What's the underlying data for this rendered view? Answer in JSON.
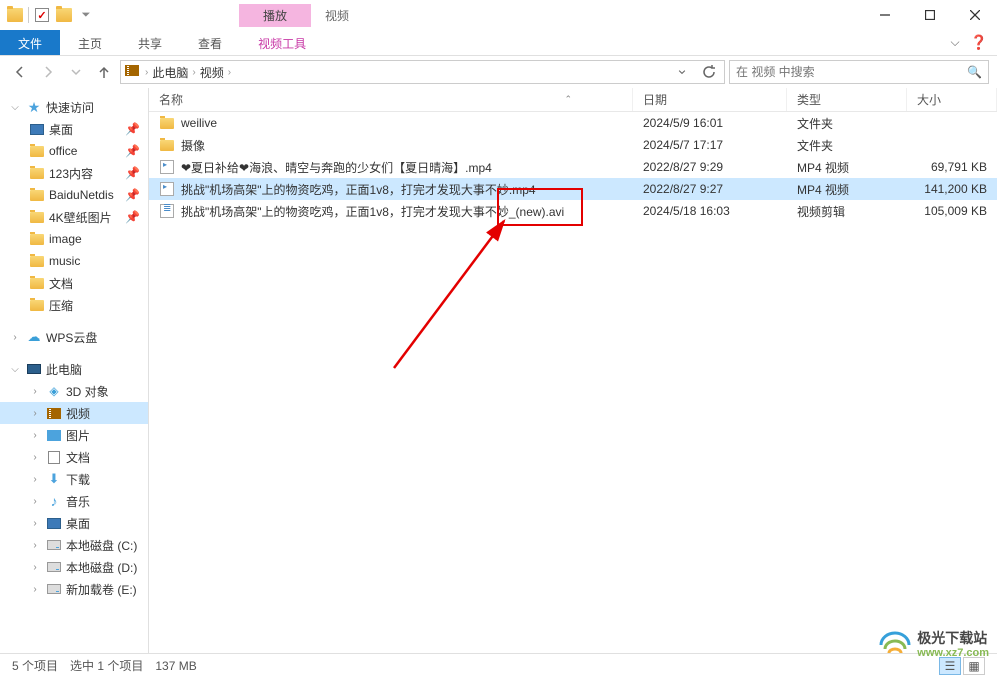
{
  "titlebar": {
    "play_label": "播放",
    "video_label": "视频"
  },
  "ribbon": {
    "tabs": [
      "文件",
      "主页",
      "共享",
      "查看",
      "视频工具"
    ]
  },
  "address": {
    "crumbs": [
      "此电脑",
      "视频"
    ],
    "search_placeholder": "在 视频 中搜索"
  },
  "columns": {
    "name": "名称",
    "date": "日期",
    "type": "类型",
    "size": "大小"
  },
  "files": [
    {
      "icon": "folder",
      "name": "weilive",
      "date": "2024/5/9 16:01",
      "type": "文件夹",
      "size": ""
    },
    {
      "icon": "folder",
      "name": "摄像",
      "date": "2024/5/7 17:17",
      "type": "文件夹",
      "size": ""
    },
    {
      "icon": "mp4",
      "name": "❤夏日补给❤海浪、晴空与奔跑的少女们【夏日晴海】.mp4",
      "date": "2022/8/27 9:29",
      "type": "MP4 视频",
      "size": "69,791 KB"
    },
    {
      "icon": "mp4",
      "name": "挑战\"机场高架\"上的物资吃鸡，正面1v8，打完才发现大事不妙.mp4",
      "date": "2022/8/27 9:27",
      "type": "MP4 视频",
      "size": "141,200 KB",
      "selected": true
    },
    {
      "icon": "video",
      "name": "挑战\"机场高架\"上的物资吃鸡，正面1v8，打完才发现大事不妙_(new).avi",
      "date": "2024/5/18 16:03",
      "type": "视频剪辑",
      "size": "105,009 KB"
    }
  ],
  "sidebar": {
    "quick_access": "快速访问",
    "quick_items": [
      {
        "label": "桌面",
        "icon": "desktop",
        "pinned": true
      },
      {
        "label": "office",
        "icon": "folder",
        "pinned": true
      },
      {
        "label": "123内容",
        "icon": "folder",
        "pinned": true
      },
      {
        "label": "BaiduNetdis",
        "icon": "folder",
        "pinned": true
      },
      {
        "label": "4K壁纸图片",
        "icon": "folder",
        "pinned": true
      },
      {
        "label": "image",
        "icon": "folder",
        "pinned": false
      },
      {
        "label": "music",
        "icon": "folder",
        "pinned": false
      },
      {
        "label": "文档",
        "icon": "folder",
        "pinned": false
      },
      {
        "label": "压缩",
        "icon": "folder",
        "pinned": false
      }
    ],
    "wps_cloud": "WPS云盘",
    "this_pc": "此电脑",
    "pc_items": [
      {
        "label": "3D 对象",
        "icon": "cube"
      },
      {
        "label": "视频",
        "icon": "video",
        "selected": true
      },
      {
        "label": "图片",
        "icon": "pic"
      },
      {
        "label": "文档",
        "icon": "doc"
      },
      {
        "label": "下载",
        "icon": "download"
      },
      {
        "label": "音乐",
        "icon": "music"
      },
      {
        "label": "桌面",
        "icon": "desktop"
      },
      {
        "label": "本地磁盘 (C:)",
        "icon": "drive"
      },
      {
        "label": "本地磁盘 (D:)",
        "icon": "drive"
      },
      {
        "label": "新加载卷 (E:)",
        "icon": "drive"
      }
    ]
  },
  "status": {
    "items": "5 个项目",
    "selected": "选中 1 个项目",
    "size": "137 MB"
  },
  "watermark": {
    "title": "极光下载站",
    "url": "www.xz7.com"
  },
  "annotation": {
    "highlight": "_(new).avi"
  }
}
